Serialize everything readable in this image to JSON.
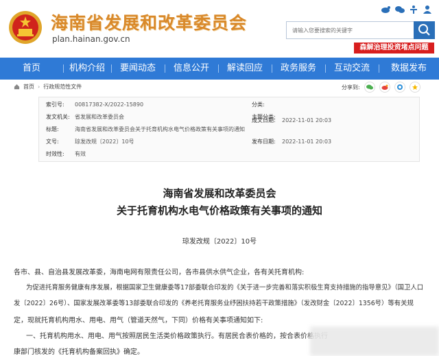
{
  "header": {
    "site_title": "海南省发展和改革委员会",
    "site_url": "plan.hainan.gov.cn",
    "search_placeholder": "请输入您要搜索的关键字",
    "banner_text": "森解治理投资堵点问题",
    "icons": [
      "weibo-icon",
      "wechat-icon",
      "accessibility-icon",
      "person-icon"
    ]
  },
  "nav": {
    "items": [
      "首页",
      "机构介绍",
      "要闻动态",
      "信息公开",
      "解读回应",
      "政务服务",
      "互动交流",
      "数据发布"
    ]
  },
  "breadcrumb": {
    "home": "首页",
    "current": "行政规范性文件"
  },
  "share": {
    "label": "分享到:"
  },
  "meta": {
    "index_label": "索引号:",
    "index_value": "00817382-X/2022-15890",
    "category_label": "分类:",
    "category_value": "",
    "issuer_label": "发文机关:",
    "issuer_value": "省发展和改革委员会",
    "subject_label": "主题分类:",
    "subject_value": "",
    "date_label": "成文日期:",
    "date_value": "2022-11-01 20:03",
    "title_label": "标题:",
    "title_value": "海南省发展和改革委员会关于托育机构水电气价格政策有关事项的通知",
    "docnum_label": "文号:",
    "docnum_value": "琼发改规〔2022〕10号",
    "pubdate_label": "发布日期:",
    "pubdate_value": "2022-11-01 20:03",
    "validity_label": "时效性:",
    "validity_value": "有效"
  },
  "document": {
    "title_line1": "海南省发展和改革委员会",
    "title_line2": "关于托育机构水电气价格政策有关事项的通知",
    "doc_number": "琼发改规〔2022〕10号",
    "addressee": "各市、县、自治县发展改革委，海南电网有限责任公司，各市县供水供气企业，各有关托育机构:",
    "para1_line1": "为促进托育服务健康有序发展，根据国家卫生健康委等17部委联合印发的《关于进一步完善和落实积极生育支持措施的指导意见》（国卫人口",
    "para1_line2": "发〔2022〕26号）、国家发展改革委等13部委联合印发的《养老托育服务业纾困扶持若干政策措施》（发改财金〔2022〕1356号）等有关规",
    "para1_line3": "定，现就托育机构用水、用电、用气（管道天然气，下同）价格有关事项通知如下:",
    "para2_line1": "一、托育机构用水、用电、用气按照居民生活类价格政策执行。有居民合表价格的，按合表价格执行",
    "para2_line2": "康部门核发的《托育机构备案回执》确定。"
  }
}
